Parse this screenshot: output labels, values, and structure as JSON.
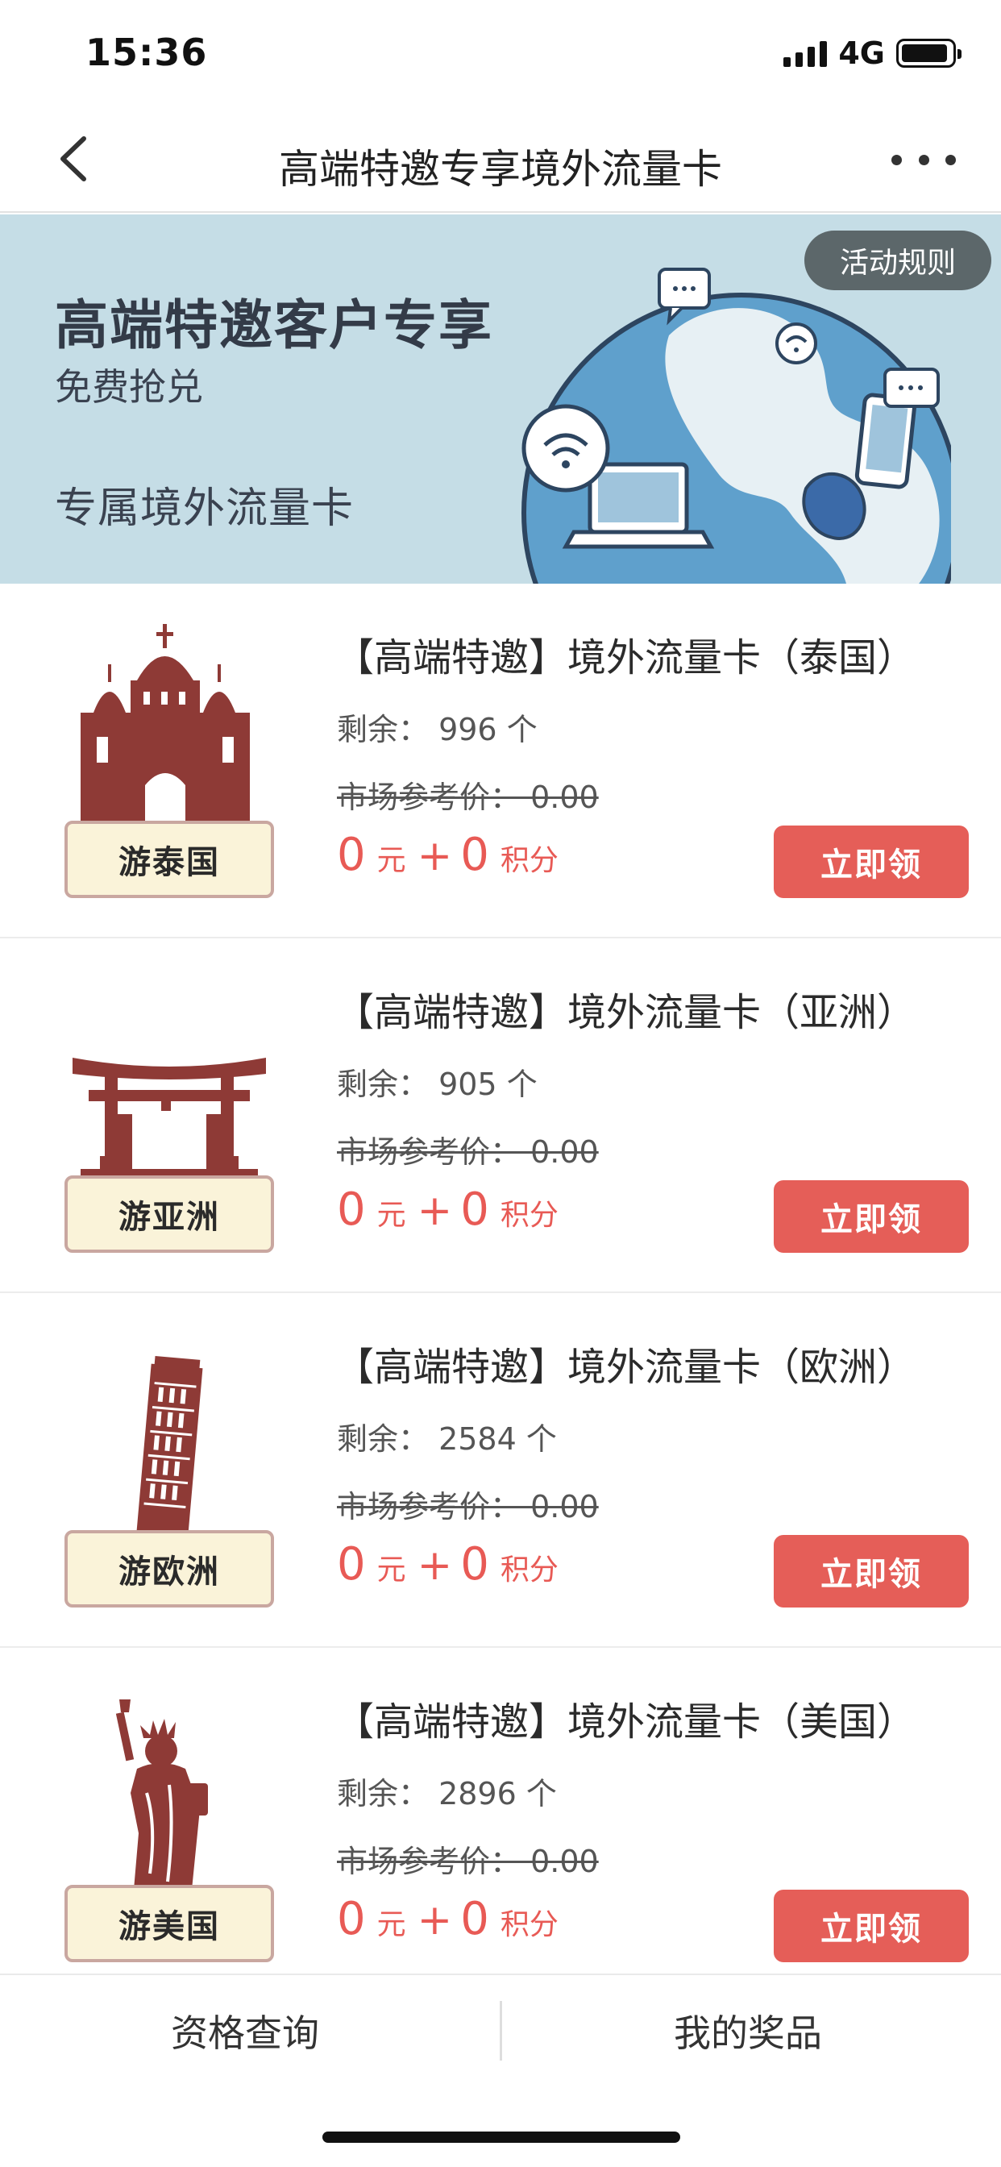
{
  "status_bar": {
    "time": "15:36",
    "network": "4G"
  },
  "nav": {
    "title": "高端特邀专享境外流量卡"
  },
  "banner": {
    "title": "高端特邀客户专享",
    "subtitle": "免费抢兑",
    "tagline": "专属境外流量卡",
    "rules_label": "活动规则"
  },
  "products": [
    {
      "title": "【高端特邀】境外流量卡（泰国）",
      "remaining": "剩余： 996 个",
      "market_price": "市场参考价： 0.00",
      "yuan": "0",
      "yuan_unit": "元",
      "plus": "+",
      "points": "0",
      "points_unit": "积分",
      "button": "立即领",
      "badge": "游泰国",
      "icon": "temple-icon"
    },
    {
      "title": "【高端特邀】境外流量卡（亚洲）",
      "remaining": "剩余： 905 个",
      "market_price": "市场参考价： 0.00",
      "yuan": "0",
      "yuan_unit": "元",
      "plus": "+",
      "points": "0",
      "points_unit": "积分",
      "button": "立即领",
      "badge": "游亚洲",
      "icon": "torii-gate-icon"
    },
    {
      "title": "【高端特邀】境外流量卡（欧洲）",
      "remaining": "剩余： 2584 个",
      "market_price": "市场参考价： 0.00",
      "yuan": "0",
      "yuan_unit": "元",
      "plus": "+",
      "points": "0",
      "points_unit": "积分",
      "button": "立即领",
      "badge": "游欧洲",
      "icon": "leaning-tower-icon"
    },
    {
      "title": "【高端特邀】境外流量卡（美国）",
      "remaining": "剩余： 2896 个",
      "market_price": "市场参考价： 0.00",
      "yuan": "0",
      "yuan_unit": "元",
      "plus": "+",
      "points": "0",
      "points_unit": "积分",
      "button": "立即领",
      "badge": "游美国",
      "icon": "statue-of-liberty-icon"
    }
  ],
  "bottom_bar": {
    "left_label": "资格查询",
    "right_label": "我的奖品"
  },
  "colors": {
    "accent": "#e55e58",
    "banner_bg": "#c5dde6",
    "icon_brown": "#8e3a36"
  }
}
